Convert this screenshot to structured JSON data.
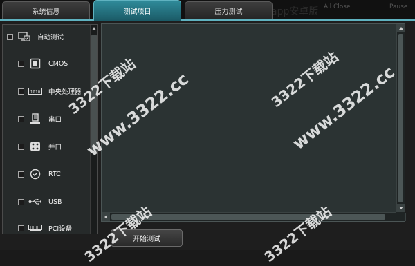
{
  "tabs": [
    {
      "label": "系统信息"
    },
    {
      "label": "测试项目"
    },
    {
      "label": "压力测试"
    }
  ],
  "header_ghost": {
    "g1": "All Close",
    "g2": "Pause",
    "g3": "app安卓版"
  },
  "sidebar": {
    "items": [
      {
        "label": "自动测试",
        "icon": "monitor-check-icon"
      },
      {
        "label": "CMOS",
        "icon": "chip-icon"
      },
      {
        "label": "中央处理器",
        "icon": "cpu-icon"
      },
      {
        "label": "串口",
        "icon": "serial-port-icon"
      },
      {
        "label": "并口",
        "icon": "parallel-port-icon"
      },
      {
        "label": "RTC",
        "icon": "clock-icon"
      },
      {
        "label": "USB",
        "icon": "usb-icon"
      },
      {
        "label": "PCI设备",
        "icon": "pci-card-icon"
      }
    ]
  },
  "buttons": {
    "start": "开始测试"
  },
  "watermarks": {
    "a": "www.3322.cc",
    "b": "www.3322.cc",
    "c": "3322下载站",
    "d": "3322下载站",
    "e": "3322下载站",
    "f": "3322下载站"
  },
  "colors": {
    "accent": "#2f8b9a",
    "panel": "#2b3333",
    "background": "#1e1e1e"
  }
}
